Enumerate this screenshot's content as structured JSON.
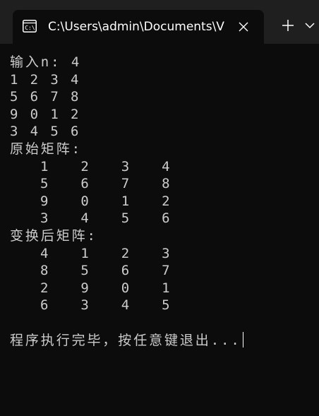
{
  "window": {
    "tab_title": "C:\\Users\\admin\\Documents\\V",
    "tab_icon": "terminal-icon",
    "close_icon": "close-icon",
    "new_tab_icon": "plus-icon",
    "dropdown_icon": "chevron-down-icon",
    "background_color": "#0c0c0c",
    "titlebar_color": "#1f1f1f",
    "text_color": "#cccccc"
  },
  "terminal": {
    "lines": [
      "输入n: 4",
      "1 2 3 4",
      "5 6 7 8",
      "9 0 1 2",
      "3 4 5 6",
      "原始矩阵:",
      "   1   2   3   4",
      "   5   6   7   8",
      "   9   0   1   2",
      "   3   4   5   6",
      "变换后矩阵:",
      "   4   1   2   3",
      "   8   5   6   7",
      "   2   9   0   1",
      "   6   3   4   5",
      "",
      "程序执行完毕，按任意键退出..."
    ]
  }
}
